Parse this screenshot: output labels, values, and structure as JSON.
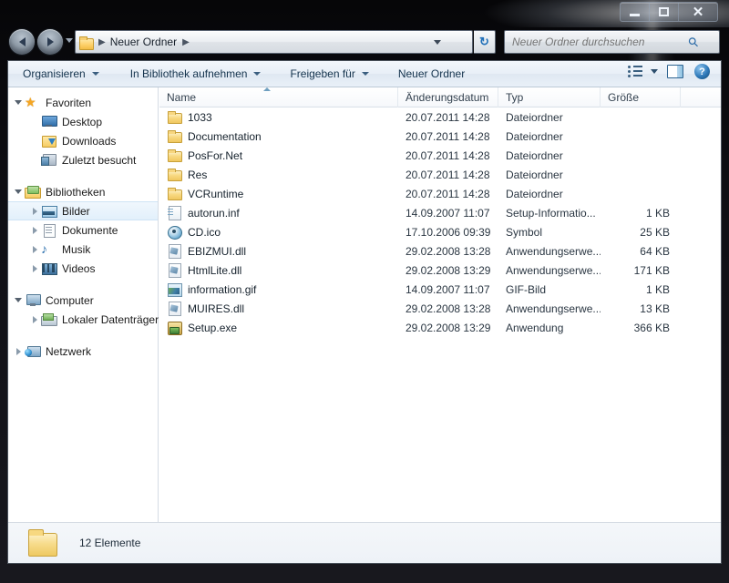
{
  "window": {
    "minimize_label": "Minimieren",
    "maximize_label": "Maximieren",
    "close_label": "Schließen"
  },
  "navigation": {
    "back_label": "Zurück",
    "forward_label": "Vorwärts",
    "recent_label": "Letzte Seiten",
    "breadcrumb": "Neuer Ordner",
    "breadcrumb_sep": "▶",
    "refresh_label": "↻"
  },
  "search": {
    "placeholder": "Neuer Ordner durchsuchen",
    "value": "",
    "icon": "search-icon"
  },
  "toolbar": {
    "organize": "Organisieren",
    "include_in_library": "In Bibliothek aufnehmen",
    "share_with": "Freigeben für",
    "new_folder": "Neuer Ordner",
    "views_label": "Ansicht ändern",
    "preview_label": "Vorschaufenster",
    "help_label": "?"
  },
  "sidebar": {
    "groups": [
      {
        "header": {
          "label": "Favoriten",
          "icon": "star-icon",
          "expanded": true
        },
        "items": [
          {
            "label": "Desktop",
            "icon": "desktop-icon",
            "expander": "none"
          },
          {
            "label": "Downloads",
            "icon": "downloads-icon",
            "expander": "none"
          },
          {
            "label": "Zuletzt besucht",
            "icon": "recent-places-icon",
            "expander": "none"
          }
        ]
      },
      {
        "header": {
          "label": "Bibliotheken",
          "icon": "library-icon",
          "expanded": true
        },
        "items": [
          {
            "label": "Bilder",
            "icon": "pictures-icon",
            "expander": "closed",
            "selected": true
          },
          {
            "label": "Dokumente",
            "icon": "documents-icon",
            "expander": "closed",
            "selected": false
          },
          {
            "label": "Musik",
            "icon": "music-icon",
            "expander": "closed",
            "selected": false
          },
          {
            "label": "Videos",
            "icon": "videos-icon",
            "expander": "closed",
            "selected": false
          }
        ]
      },
      {
        "header": {
          "label": "Computer",
          "icon": "computer-icon",
          "expanded": true
        },
        "items": [
          {
            "label": "Lokaler Datenträger",
            "icon": "drive-icon",
            "expander": "closed"
          }
        ]
      },
      {
        "header": {
          "label": "Netzwerk",
          "icon": "network-icon",
          "expanded": false
        },
        "items": []
      }
    ]
  },
  "filelist": {
    "columns": [
      {
        "key": "name",
        "label": "Name",
        "sorted": "asc"
      },
      {
        "key": "date",
        "label": "Änderungsdatum"
      },
      {
        "key": "type",
        "label": "Typ"
      },
      {
        "key": "size",
        "label": "Größe"
      }
    ],
    "rows": [
      {
        "name": "1033",
        "date": "20.07.2011 14:28",
        "type": "Dateiordner",
        "size": "",
        "icon": "folder-icon"
      },
      {
        "name": "Documentation",
        "date": "20.07.2011 14:28",
        "type": "Dateiordner",
        "size": "",
        "icon": "folder-icon"
      },
      {
        "name": "PosFor.Net",
        "date": "20.07.2011 14:28",
        "type": "Dateiordner",
        "size": "",
        "icon": "folder-icon"
      },
      {
        "name": "Res",
        "date": "20.07.2011 14:28",
        "type": "Dateiordner",
        "size": "",
        "icon": "folder-icon"
      },
      {
        "name": "VCRuntime",
        "date": "20.07.2011 14:28",
        "type": "Dateiordner",
        "size": "",
        "icon": "folder-icon"
      },
      {
        "name": "autorun.inf",
        "date": "14.09.2007 11:07",
        "type": "Setup-Informatio...",
        "size": "1 KB",
        "icon": "inf-file-icon"
      },
      {
        "name": "CD.ico",
        "date": "17.10.2006 09:39",
        "type": "Symbol",
        "size": "25 KB",
        "icon": "ico-file-icon"
      },
      {
        "name": "EBIZMUI.dll",
        "date": "29.02.2008 13:28",
        "type": "Anwendungserwe...",
        "size": "64 KB",
        "icon": "dll-file-icon"
      },
      {
        "name": "HtmlLite.dll",
        "date": "29.02.2008 13:29",
        "type": "Anwendungserwe...",
        "size": "171 KB",
        "icon": "dll-file-icon"
      },
      {
        "name": "information.gif",
        "date": "14.09.2007 11:07",
        "type": "GIF-Bild",
        "size": "1 KB",
        "icon": "gif-file-icon"
      },
      {
        "name": "MUIRES.dll",
        "date": "29.02.2008 13:28",
        "type": "Anwendungserwe...",
        "size": "13 KB",
        "icon": "dll-file-icon"
      },
      {
        "name": "Setup.exe",
        "date": "29.02.2008 13:29",
        "type": "Anwendung",
        "size": "366 KB",
        "icon": "exe-file-icon"
      }
    ]
  },
  "statusbar": {
    "item_count_text": "12 Elemente",
    "icon": "folder-icon"
  },
  "colors": {
    "accent": "#2f79b9",
    "folder_yellow": "#f8d982",
    "selection_blue": "#e2f0fb",
    "frame_dark": "#101016"
  }
}
